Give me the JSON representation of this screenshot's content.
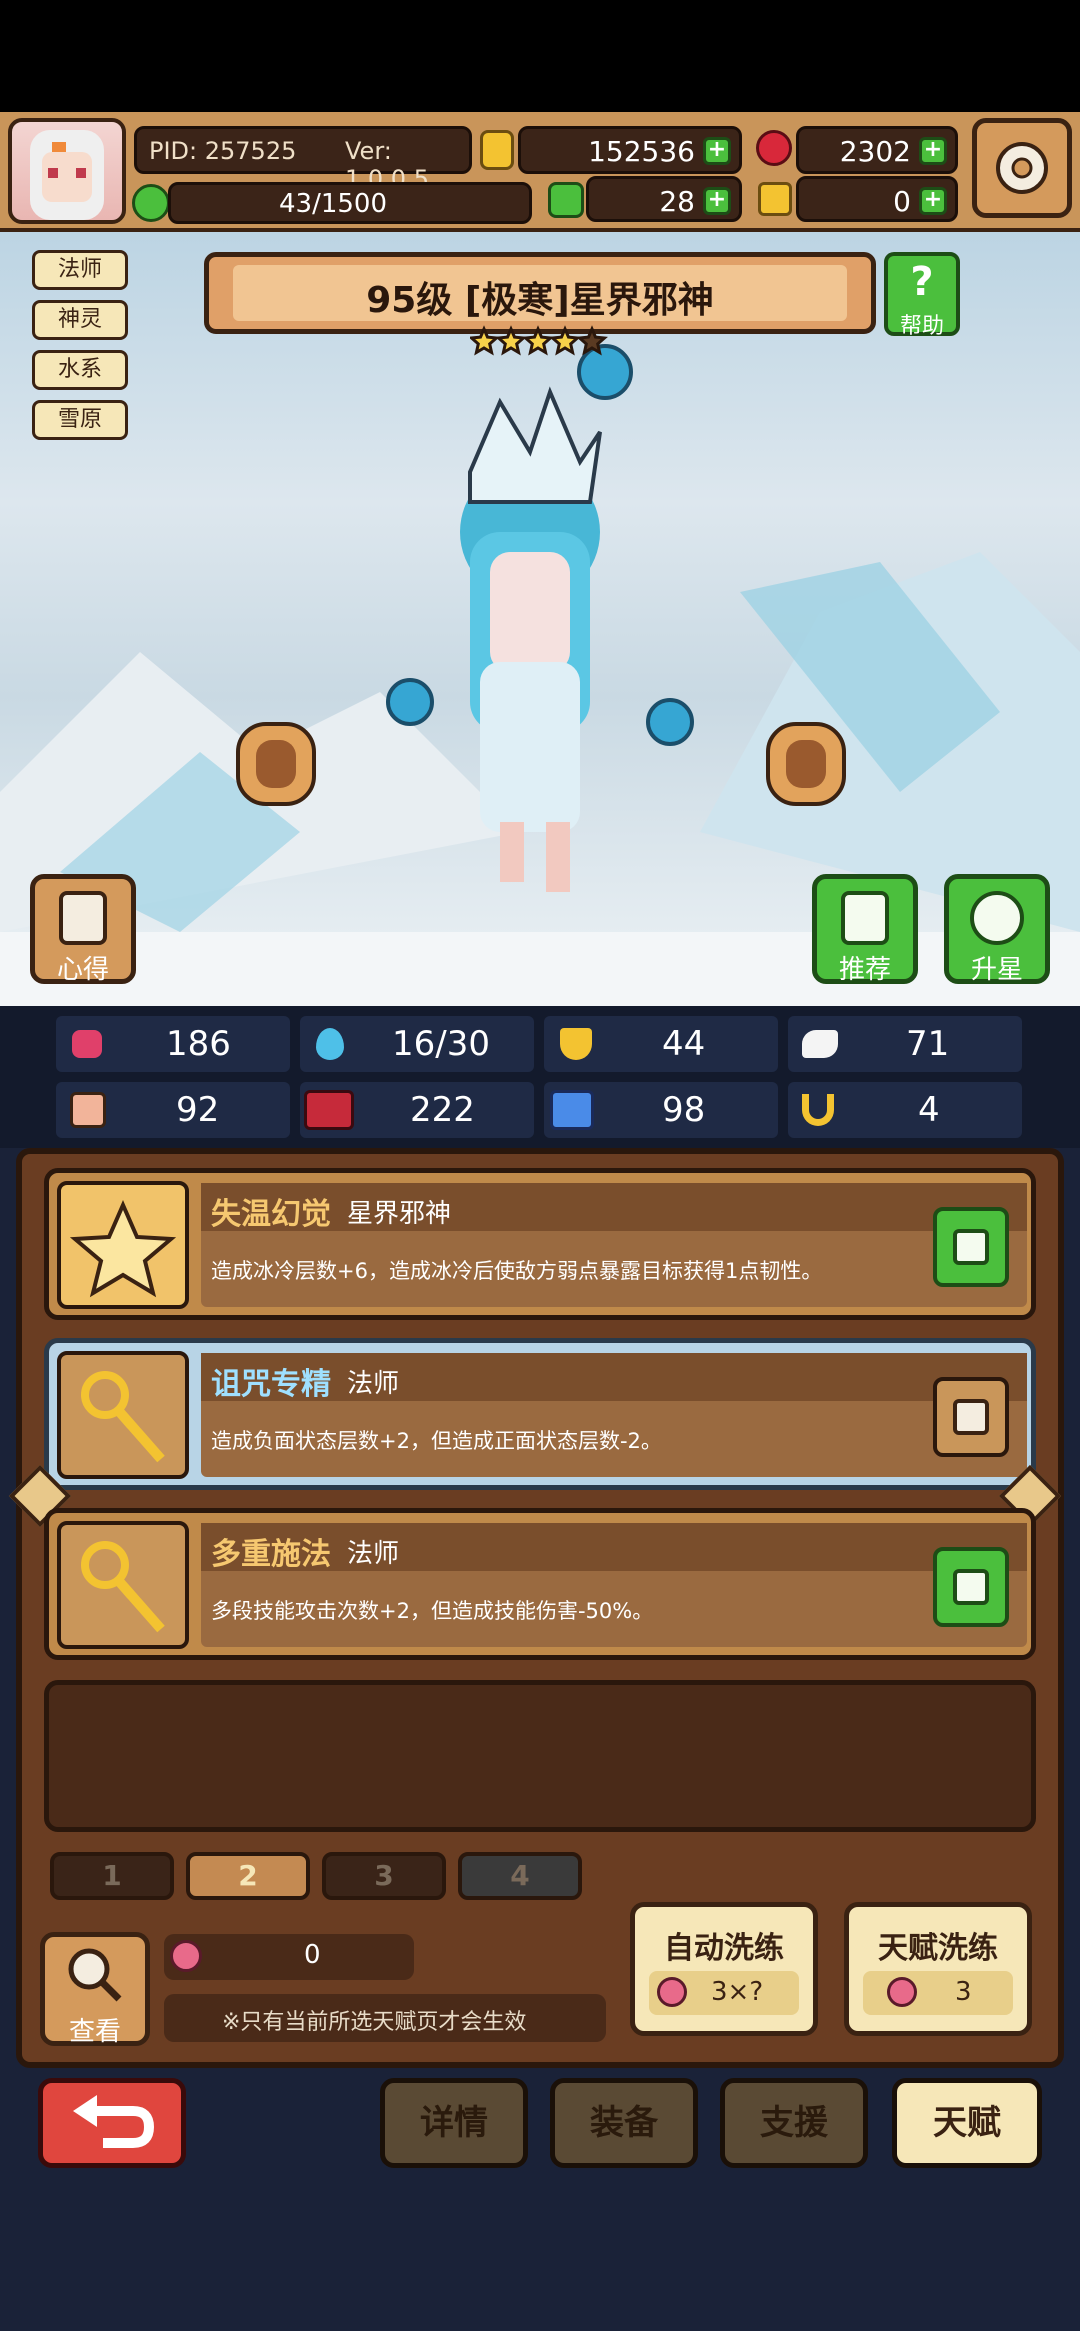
{
  "header": {
    "pid": "PID: 257525",
    "version": "Ver: 1.0.0.5",
    "gold": "152536",
    "gems": "2302",
    "stamina": "43/1500",
    "clover": "28",
    "keys": "0"
  },
  "tags": [
    "法师",
    "神灵",
    "水系",
    "雪原"
  ],
  "hero": {
    "title": "95级  [极寒]星界邪神",
    "stars": 4,
    "max_stars": 5,
    "help_label": "帮助"
  },
  "side_buttons": {
    "notes": "心得",
    "recommend": "推荐",
    "star_up": "升星"
  },
  "stats": {
    "hp": "186",
    "mana": "16/30",
    "defense": "44",
    "speed": "71",
    "attack": "92",
    "magic": "222",
    "book": "98",
    "luck": "4"
  },
  "talents": [
    {
      "name": "失温幻觉",
      "category": "星界邪神",
      "desc": "造成冰冷层数+6，造成冰冷后使敌方弱点暴露目标获得1点韧性。"
    },
    {
      "name": "诅咒专精",
      "category": "法师",
      "desc": "造成负面状态层数+2，但造成正面状态层数-2。"
    },
    {
      "name": "多重施法",
      "category": "法师",
      "desc": "多段技能攻击次数+2，但造成技能伤害-50%。"
    }
  ],
  "pages": [
    "1",
    "2",
    "3",
    "4"
  ],
  "reroll": {
    "view_label": "查看",
    "potion_count": "0",
    "note": "※只有当前所选天赋页才会生效",
    "auto_label": "自动洗练",
    "auto_cost": "3×?",
    "talent_label": "天赋洗练",
    "talent_cost": "3"
  },
  "bottom_nav": {
    "details": "详情",
    "equipment": "装备",
    "support": "支援",
    "talent": "天赋"
  },
  "colors": {
    "accent_gold": "#f6c870",
    "green": "#4bbf3d",
    "red_back": "#e0463e",
    "panel_brown": "#6a3d22"
  }
}
